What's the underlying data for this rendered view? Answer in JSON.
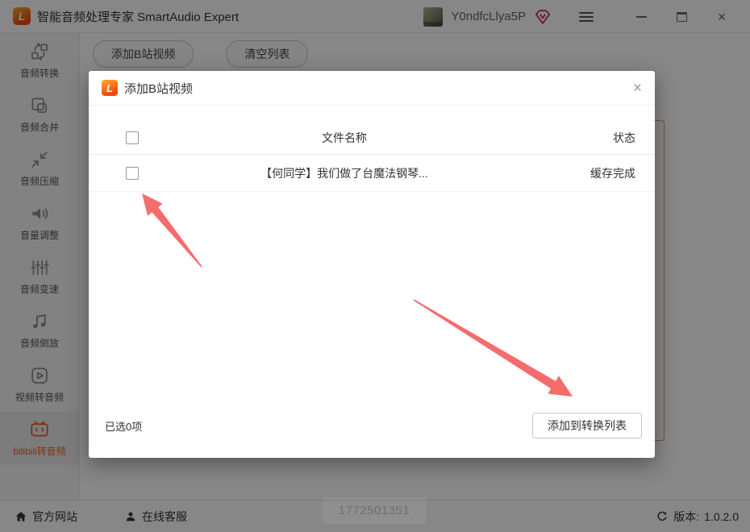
{
  "titlebar": {
    "logo_letter": "L",
    "app_title": "智能音频处理专家 SmartAudio Expert",
    "username": "Y0ndfcLlya5P"
  },
  "sidebar": {
    "items": [
      {
        "label": "音频转换",
        "icon": "convert-icon",
        "active": false
      },
      {
        "label": "音频合并",
        "icon": "merge-icon",
        "active": false
      },
      {
        "label": "音频压缩",
        "icon": "compress-icon",
        "active": false
      },
      {
        "label": "音量调整",
        "icon": "volume-icon",
        "active": false
      },
      {
        "label": "音频变速",
        "icon": "speed-icon",
        "active": false
      },
      {
        "label": "音频倒放",
        "icon": "reverse-icon",
        "active": false
      },
      {
        "label": "视频转音频",
        "icon": "video-to-audio-icon",
        "active": false
      },
      {
        "label": "bilibili转音频",
        "icon": "bilibili-tv-icon",
        "active": true
      }
    ]
  },
  "toolbar": {
    "add_video_button": "添加B站视频",
    "clear_list_button": "清空列表"
  },
  "modal": {
    "logo_letter": "L",
    "title": "添加B站视频",
    "close_glyph": "×",
    "table": {
      "name_header": "文件名称",
      "status_header": "状态",
      "rows": [
        {
          "name": "【何同学】我们做了台魔法钢琴...",
          "status": "缓存完成",
          "checked": false
        }
      ]
    },
    "selected_count": "已选0项",
    "confirm_button": "添加到转换列表"
  },
  "background_hint": {
    "text": "1772501351"
  },
  "footer": {
    "website": "官方网站",
    "support": "在线客服",
    "version_label": "版本:",
    "version": "1.0.2.0"
  },
  "colors": {
    "accent_orange": "#e8641c",
    "logo_gradient_top": "#ffaa2b",
    "logo_gradient_bottom": "#f0480e",
    "arrow_red": "#f56c6c",
    "vip_badge_red": "#cf3449",
    "dropzone_border": "#dc9a66",
    "overlay": "rgba(0,0,0,0.47)"
  }
}
